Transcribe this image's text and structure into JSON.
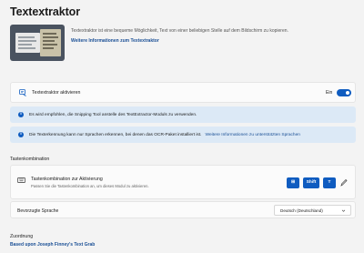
{
  "page": {
    "title": "Textextraktor"
  },
  "hero": {
    "description": "Textextraktor ist eine bequeme Möglichkeit, Text von einer beliebigen Stelle auf dem Bildschirm zu kopieren.",
    "link": "Weitere Informationen zum Textextraktor"
  },
  "enable": {
    "label": "Textextraktor aktivieren",
    "state": "Ein",
    "on": true,
    "icon": "text-extractor-icon"
  },
  "info": [
    {
      "text": "Es wird empfohlen, die Snipping Tool anstelle des TextExtractor-Moduls zu verwenden.",
      "link": ""
    },
    {
      "text": "Die Texterkennung kann nur Sprachen erkennen, bei denen das OCR-Paket installiert ist.",
      "link": "Weitere Informationen zu unterstützten Sprachen"
    }
  ],
  "shortcut_section": {
    "label": "Tastenkombination",
    "title": "Tastenkombination zur Aktivierung",
    "description": "Passen Sie die Tastenkombination an, um dieses Modul zu aktivieren.",
    "keys": [
      "⊞",
      "Shift",
      "T"
    ],
    "edit_icon": "pencil-icon"
  },
  "language": {
    "label": "Bevorzugte Sprache",
    "value": "Deutsch (Deutschland)"
  },
  "credits": {
    "title": "Zuordnung",
    "link": "Based upon Joseph Finney's Text Grab"
  },
  "colors": {
    "accent": "#0f5cc0",
    "link": "#1a4f95",
    "info_bg": "#dce9f6",
    "background": "#f3f3f3"
  }
}
